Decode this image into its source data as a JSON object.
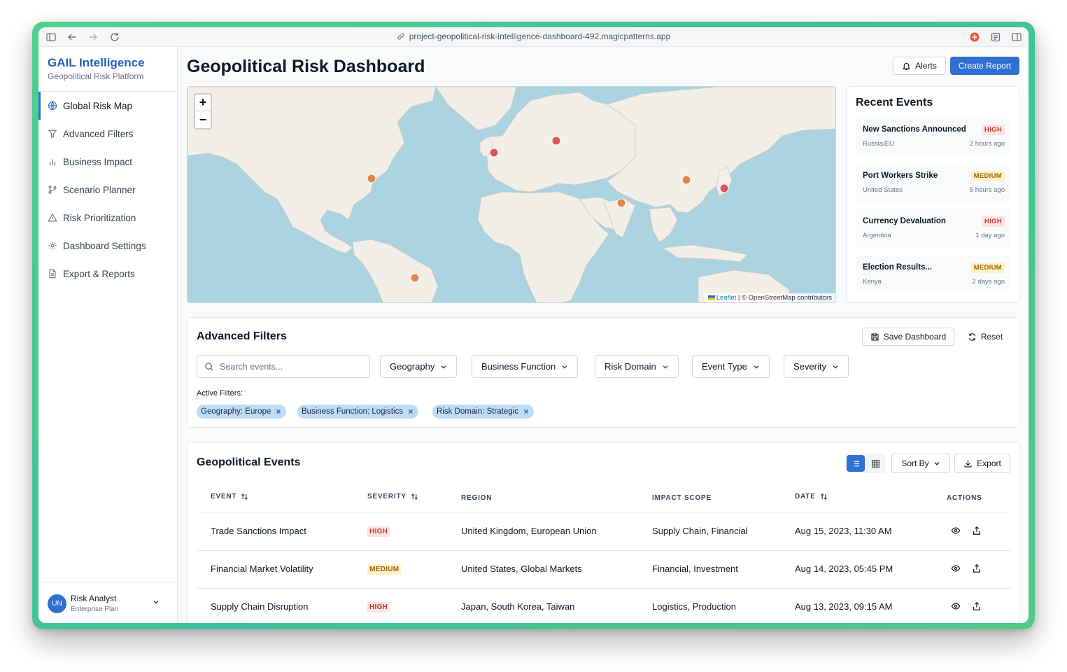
{
  "browser": {
    "url": "project-geopolitical-risk-intelligence-dashboard-492.magicpatterns.app"
  },
  "brand": {
    "title": "GAIL Intelligence",
    "subtitle": "Geopolitical Risk Platform"
  },
  "nav": {
    "items": [
      {
        "label": "Global Risk Map",
        "icon": "globe-icon",
        "active": true
      },
      {
        "label": "Advanced Filters",
        "icon": "filter-icon"
      },
      {
        "label": "Business Impact",
        "icon": "bar-chart-icon"
      },
      {
        "label": "Scenario Planner",
        "icon": "git-branch-icon"
      },
      {
        "label": "Risk Prioritization",
        "icon": "alert-triangle-icon"
      },
      {
        "label": "Dashboard Settings",
        "icon": "gear-icon"
      },
      {
        "label": "Export & Reports",
        "icon": "file-text-icon"
      }
    ]
  },
  "user": {
    "initials": "UN",
    "name": "Risk Analyst",
    "plan": "Enterprise Plan"
  },
  "header": {
    "title": "Geopolitical Risk Dashboard",
    "alerts_label": "Alerts",
    "create_label": "Create Report"
  },
  "map": {
    "zoom_in": "+",
    "zoom_out": "−",
    "attribution_link": "Leaflet",
    "attribution_text": " | © OpenStreetMap contributors",
    "marker_colors": {
      "high": "#e05555",
      "medium": "#e0874a"
    }
  },
  "recent": {
    "title": "Recent Events",
    "items": [
      {
        "name": "New Sanctions Announced",
        "severity": "HIGH",
        "region": "Russia/EU",
        "time": "2 hours ago"
      },
      {
        "name": "Port Workers Strike",
        "severity": "MEDIUM",
        "region": "United States",
        "time": "5 hours ago"
      },
      {
        "name": "Currency Devaluation",
        "severity": "HIGH",
        "region": "Argentina",
        "time": "1 day ago"
      },
      {
        "name": "Election Results...",
        "severity": "MEDIUM",
        "region": "Kenya",
        "time": "2 days ago"
      }
    ]
  },
  "filters": {
    "title": "Advanced Filters",
    "save_label": "Save Dashboard",
    "reset_label": "Reset",
    "search_placeholder": "Search events...",
    "dropdowns": [
      "Geography",
      "Business Function",
      "Risk Domain",
      "Event Type",
      "Severity"
    ],
    "active_label": "Active Filters:",
    "active": [
      "Geography: Europe",
      "Business Function: Logistics",
      "Risk Domain: Strategic"
    ]
  },
  "events": {
    "title": "Geopolitical Events",
    "sort_label": "Sort By",
    "export_label": "Export",
    "columns": [
      "EVENT",
      "SEVERITY",
      "REGION",
      "IMPACT SCOPE",
      "DATE",
      "ACTIONS"
    ],
    "rows": [
      {
        "event": "Trade Sanctions Impact",
        "severity": "HIGH",
        "region": "United Kingdom, European Union",
        "scope": "Supply Chain, Financial",
        "date": "Aug 15, 2023, 11:30 AM"
      },
      {
        "event": "Financial Market Volatility",
        "severity": "MEDIUM",
        "region": "United States, Global Markets",
        "scope": "Financial, Investment",
        "date": "Aug 14, 2023, 05:45 PM"
      },
      {
        "event": "Supply Chain Disruption",
        "severity": "HIGH",
        "region": "Japan, South Korea, Taiwan",
        "scope": "Logistics, Production",
        "date": "Aug 13, 2023, 09:15 AM"
      }
    ]
  }
}
